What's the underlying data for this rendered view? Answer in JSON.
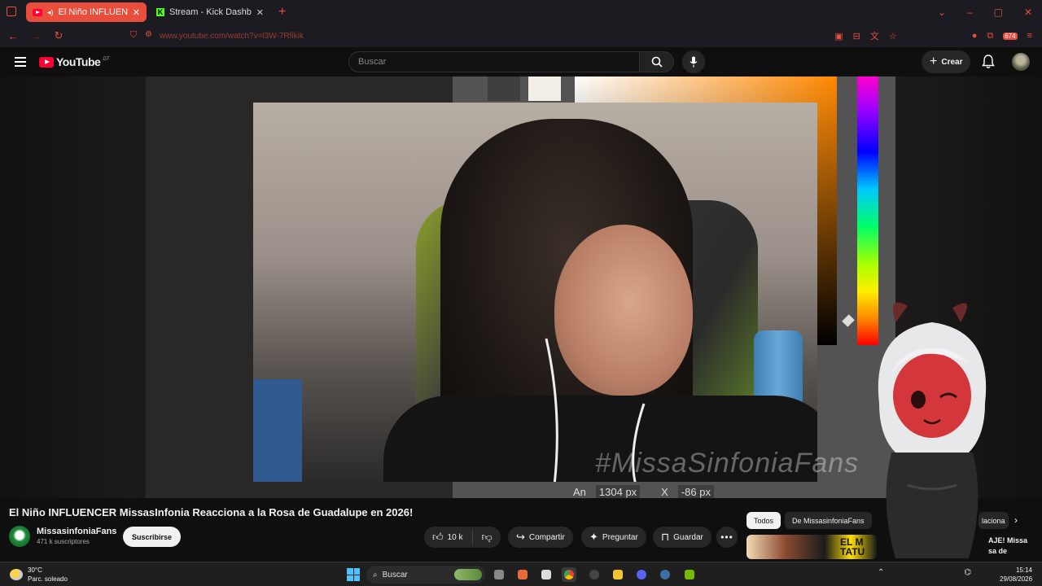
{
  "browser": {
    "tabs": [
      {
        "label": "El Niño INFLUENCER Missa",
        "active": true
      },
      {
        "label": "Stream - Kick Dashboard",
        "active": false
      }
    ],
    "url": "www.youtube.com/watch?v=l3W-7Rfikik",
    "extension_badge": "674",
    "accent_color": "#e94d3c"
  },
  "youtube": {
    "logo_text": "YouTube",
    "region": "GT",
    "search_placeholder": "Buscar",
    "create_label": "Crear"
  },
  "video": {
    "watermark": "#MissaSinfoniaFans",
    "editor_width_label": "An",
    "editor_width_value": "1304 px",
    "editor_x_label": "X",
    "editor_x_value": "-86 px",
    "title": "El Niño INFLUENCER MissasInfonia Reacciona a la Rosa de Guadalupe en 2026!"
  },
  "channel": {
    "name": "MissasinfoniaFans",
    "subscribers": "471 k suscriptores",
    "subscribe_label": "Suscribirse"
  },
  "actions": {
    "likes": "10 k",
    "share": "Compartir",
    "ask": "Preguntar",
    "save": "Guardar"
  },
  "sidebar": {
    "chips": [
      "Todos",
      "De MissasinfoniaFans",
      "laciona"
    ],
    "rec_title": "AJE! Missa\nsa de",
    "rec_thumb_text": "EL M\nTATU"
  },
  "taskbar": {
    "temperature": "30°C",
    "weather": "Parc. soleado",
    "search_label": "Buscar",
    "time": "15:14",
    "date": "29/08/2026"
  }
}
